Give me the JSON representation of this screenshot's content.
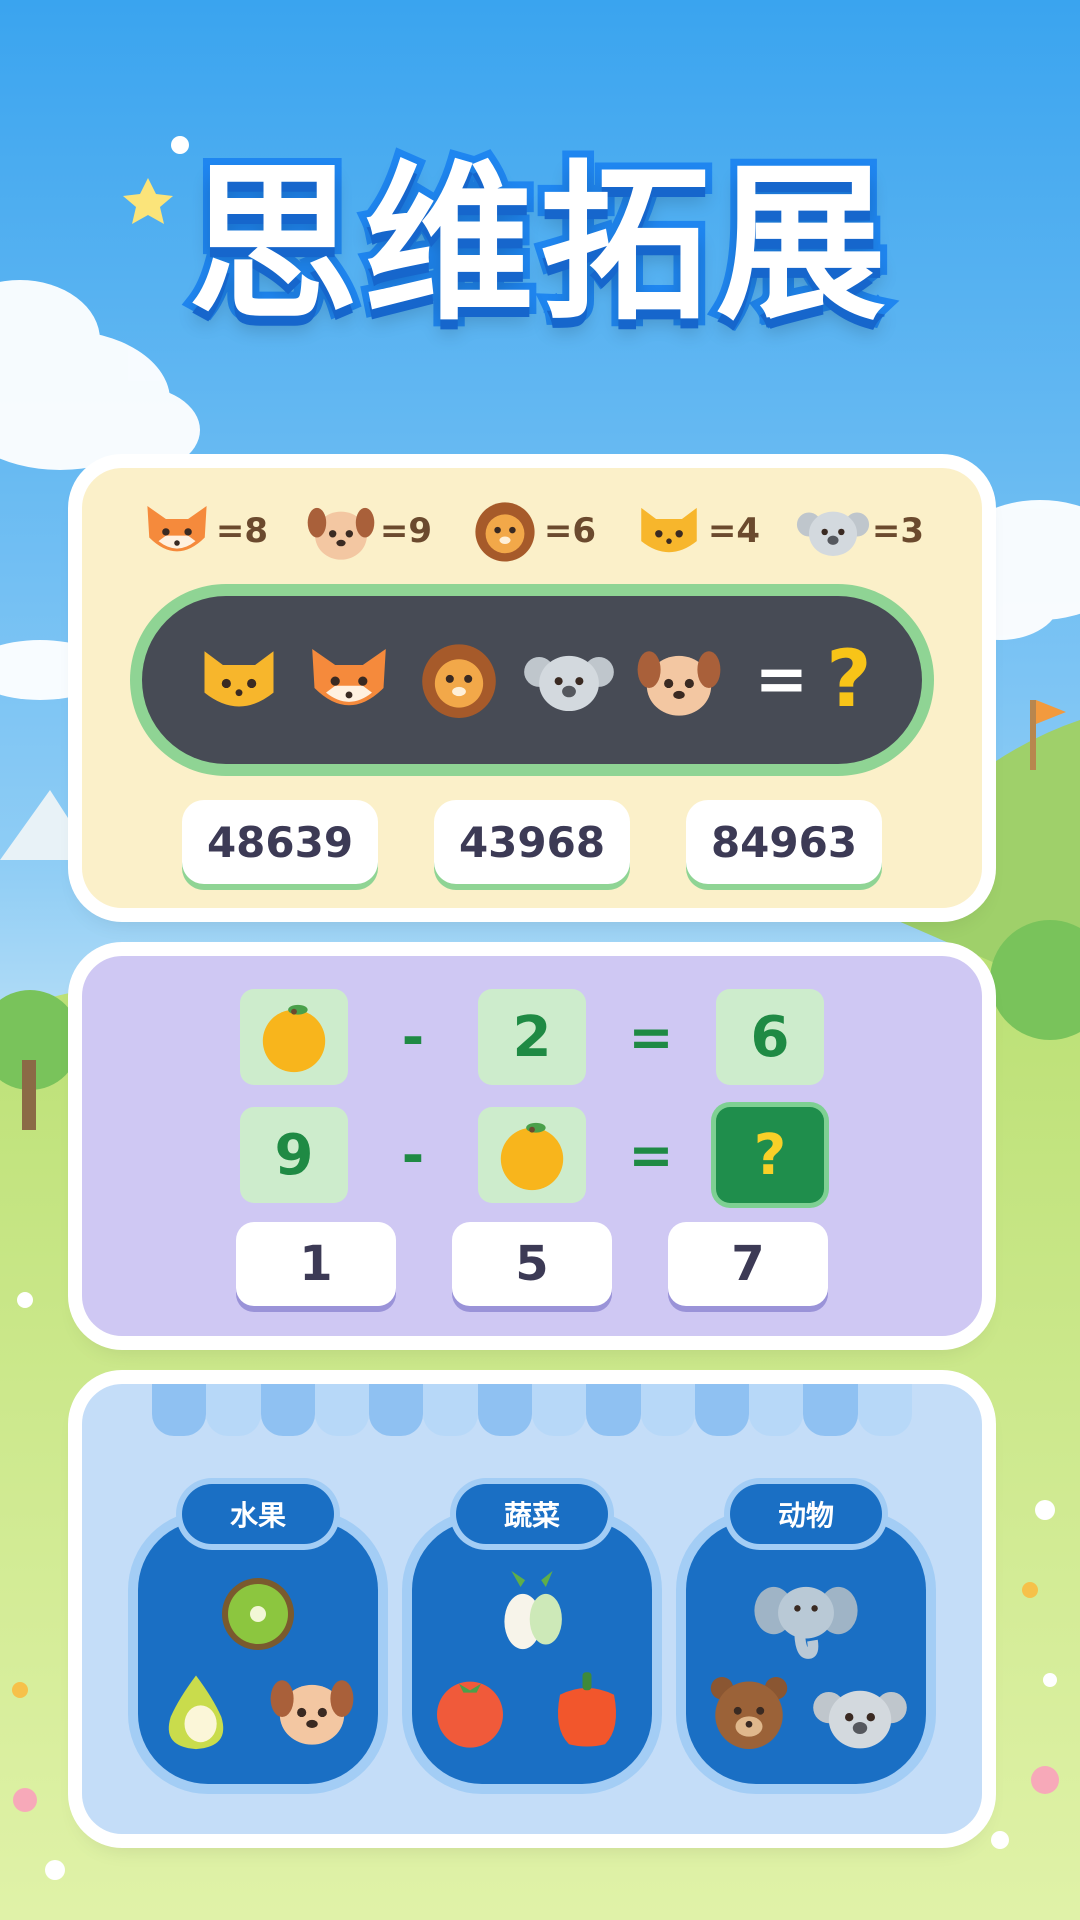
{
  "title": "思维拓展",
  "puzzle1": {
    "legend": [
      {
        "icon": "fox-icon",
        "value": "=8"
      },
      {
        "icon": "dog-icon",
        "value": "=9"
      },
      {
        "icon": "lion-icon",
        "value": "=6"
      },
      {
        "icon": "cat-icon",
        "value": "=4"
      },
      {
        "icon": "koala-icon",
        "value": "=3"
      }
    ],
    "sequence": [
      "cat-icon",
      "fox-icon",
      "lion-icon",
      "koala-icon",
      "dog-icon"
    ],
    "equals": "=",
    "question": "?",
    "options": [
      "48639",
      "43968",
      "84963"
    ]
  },
  "puzzle2": {
    "row1": {
      "a": "orange-icon",
      "op": "-",
      "b": "2",
      "eq": "=",
      "result": "6"
    },
    "row2": {
      "a": "9",
      "op": "-",
      "b": "orange-icon",
      "eq": "=",
      "result": "?"
    },
    "options": [
      "1",
      "5",
      "7"
    ]
  },
  "puzzle3": {
    "jars": [
      {
        "label": "水果",
        "items": [
          "kiwi-icon",
          "pear-icon",
          "dog-icon"
        ]
      },
      {
        "label": "蔬菜",
        "items": [
          "radish-icon",
          "tomato-icon",
          "pepper-icon"
        ]
      },
      {
        "label": "动物",
        "items": [
          "elephant-icon",
          "bear-icon",
          "koala-icon"
        ]
      }
    ]
  },
  "colors": {
    "sky": "#5bb4f2",
    "grass": "#b8de7a",
    "title_stroke": "#1f86f0",
    "green_accent": "#1f8e4c"
  }
}
